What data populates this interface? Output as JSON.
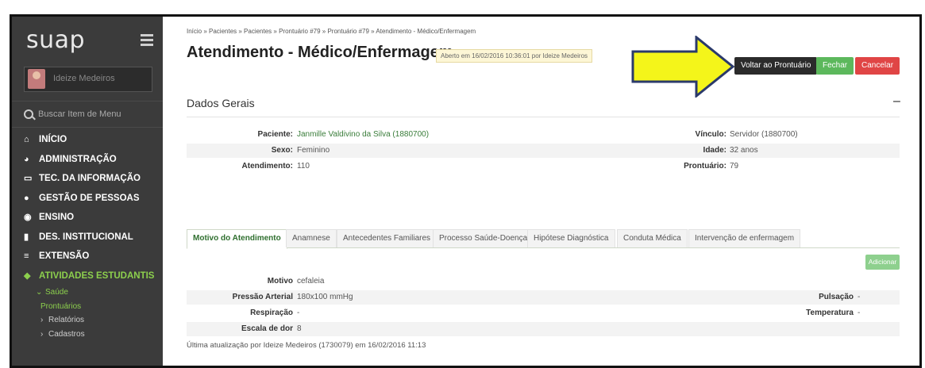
{
  "sidebar": {
    "logo": "suap",
    "user_name": "Ideize Medeiros",
    "search_label": "Buscar Item de Menu",
    "items": [
      {
        "label": "INÍCIO",
        "icon": "home-icon",
        "glyph": "🏠"
      },
      {
        "label": "ADMINISTRAÇÃO",
        "icon": "leaf-icon",
        "glyph": "◕"
      },
      {
        "label": "TEC. DA INFORMAÇÃO",
        "icon": "monitor-icon",
        "glyph": "▭"
      },
      {
        "label": "GESTÃO DE PESSOAS",
        "icon": "user-icon",
        "glyph": "●"
      },
      {
        "label": "ENSINO",
        "icon": "pencil-icon",
        "glyph": "◉"
      },
      {
        "label": "DES. INSTITUCIONAL",
        "icon": "bar-chart-icon",
        "glyph": "▮"
      },
      {
        "label": "EXTENSÃO",
        "icon": "list-icon",
        "glyph": "≡"
      },
      {
        "label": "ATIVIDADES ESTUDANTIS",
        "icon": "graduation-icon",
        "glyph": "◆"
      }
    ],
    "sub_saude": "Saúde",
    "sub_prontuarios": "Prontuários",
    "sub_relatorios": "Relatórios",
    "sub_cadastros": "Cadastros"
  },
  "header": {
    "breadcrumb": "Início » Pacientes » Pacientes » Prontuário #79 » Prontuário #79 » Atendimento - Médico/Enfermagem",
    "title": "Atendimento - Médico/Enfermagem",
    "opened_badge": "Aberto em 16/02/2016 10:36:01 por Ideize Medeiros",
    "back_button": "Voltar ao Prontuário",
    "close_button": "Fechar",
    "cancel_button": "Cancelar"
  },
  "general": {
    "section_title": "Dados Gerais",
    "toggle": "–",
    "paciente_label": "Paciente:",
    "paciente_value": "Janmille Valdivino da Silva (1880700)",
    "vinculo_label": "Vínculo:",
    "vinculo_value": "Servidor (1880700)",
    "sexo_label": "Sexo:",
    "sexo_value": "Feminino",
    "idade_label": "Idade:",
    "idade_value": "32 anos",
    "atendimento_label": "Atendimento:",
    "atendimento_value": "110",
    "prontuario_label": "Prontuário:",
    "prontuario_value": "79"
  },
  "tabs": [
    "Motivo do Atendimento",
    "Anamnese",
    "Antecedentes Familiares",
    "Processo Saúde-Doença",
    "Hipótese Diagnóstica",
    "Conduta Médica",
    "Intervenção de enfermagem"
  ],
  "motivo": {
    "add_button": "Adicionar",
    "motivo_label": "Motivo",
    "motivo_value": "cefaleia",
    "pressao_label": "Pressão Arterial",
    "pressao_value": "180x100 mmHg",
    "pulsacao_label": "Pulsação",
    "pulsacao_value": "-",
    "respiracao_label": "Respiração",
    "respiracao_value": "-",
    "temperatura_label": "Temperatura",
    "temperatura_value": "-",
    "dor_label": "Escala de dor",
    "dor_value": "8",
    "last_update": "Última atualização por Ideize Medeiros (1730079) em 16/02/2016 11:13"
  },
  "colors": {
    "sidebar_bg": "#3b3b3b",
    "accent_green": "#5cb85c",
    "danger": "#e04545",
    "arrow_fill": "#f4f51a"
  }
}
